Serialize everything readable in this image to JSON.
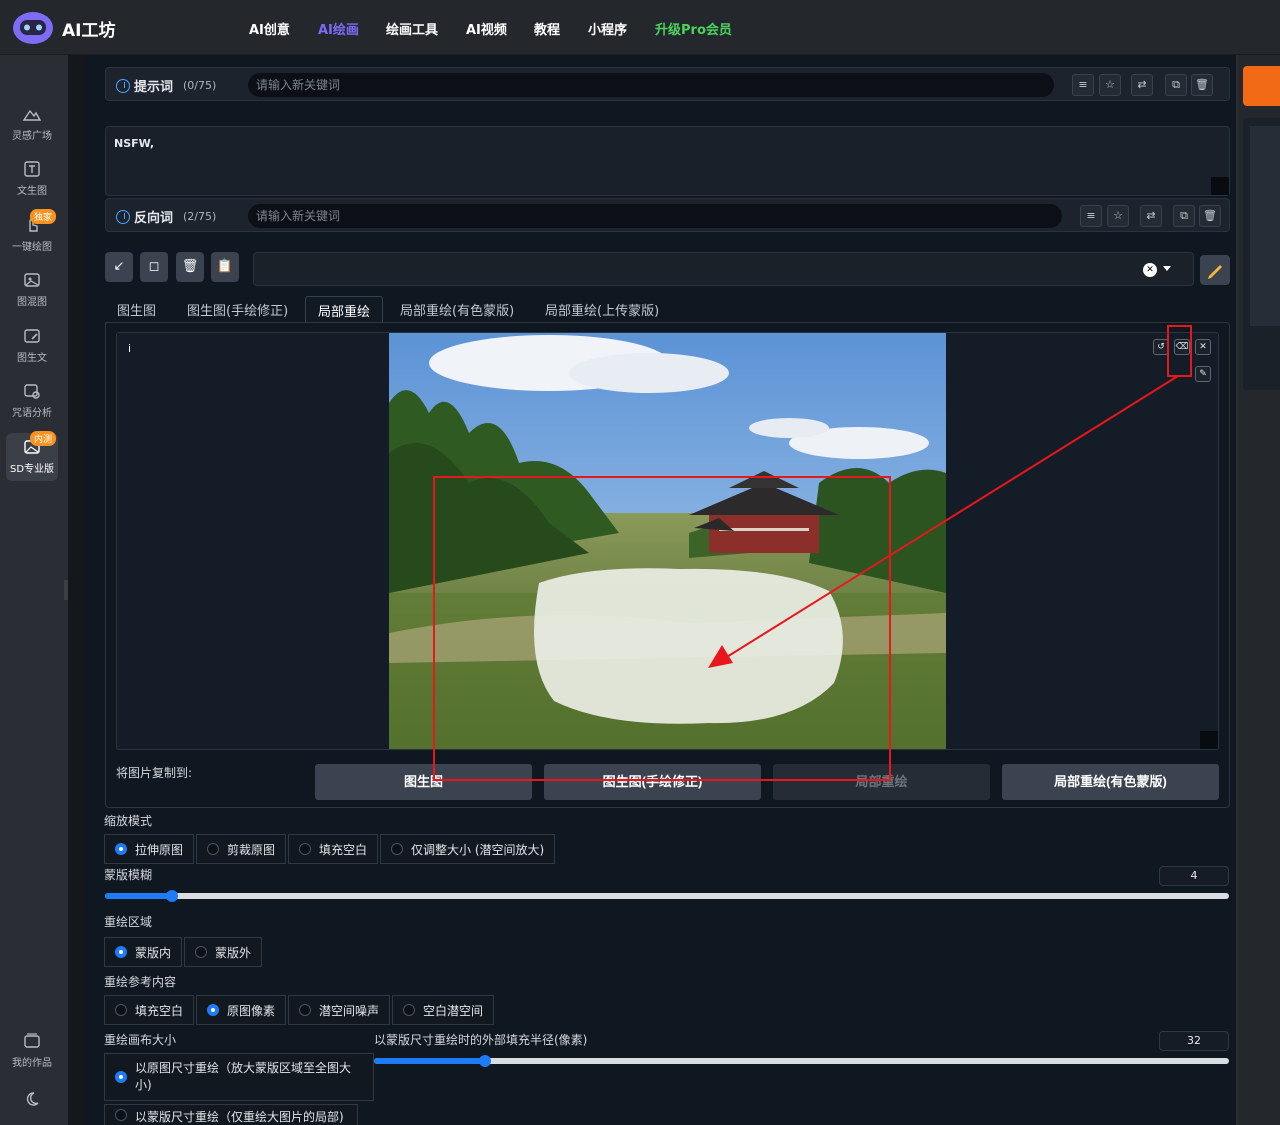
{
  "app": {
    "title": "AI工坊"
  },
  "nav": {
    "items": [
      {
        "label": "AI创意"
      },
      {
        "label": "AI绘画"
      },
      {
        "label": "绘画工具"
      },
      {
        "label": "AI视频"
      },
      {
        "label": "教程"
      },
      {
        "label": "小程序"
      },
      {
        "label": "升级Pro会员"
      }
    ],
    "active": "AI绘画"
  },
  "sidebar": {
    "items": [
      {
        "label": "灵感广场",
        "icon": "mountain-icon"
      },
      {
        "label": "文生图",
        "icon": "text-image-icon"
      },
      {
        "label": "一键绘图",
        "icon": "hand-pointer-icon",
        "badge": "独家"
      },
      {
        "label": "图混图",
        "icon": "image-mix-icon"
      },
      {
        "label": "图生文",
        "icon": "image-edit-icon"
      },
      {
        "label": "咒语分析",
        "icon": "image-search-icon"
      },
      {
        "label": "SD专业版",
        "icon": "image-pro-icon",
        "badge": "内测",
        "active": true
      }
    ],
    "bottom": [
      {
        "label": "我的作品",
        "icon": "gallery-icon"
      },
      {
        "label": "",
        "icon": "theme-toggle-icon"
      }
    ]
  },
  "prompt": {
    "label": "提示词",
    "count": "(0/75)",
    "placeholder": "请输入新关键词",
    "text": "NSFW,"
  },
  "negative": {
    "label": "反向词",
    "count": "(2/75)",
    "placeholder": "请输入新关键词"
  },
  "tabs": [
    {
      "label": "图生图"
    },
    {
      "label": "图生图(手绘修正)"
    },
    {
      "label": "局部重绘",
      "active": true
    },
    {
      "label": "局部重绘(有色蒙版)"
    },
    {
      "label": "局部重绘(上传蒙版)"
    }
  ],
  "canvas": {
    "info": "i"
  },
  "copy_to": {
    "label": "将图片复制到:",
    "buttons": [
      {
        "label": "图生图"
      },
      {
        "label": "图生图(手绘修正)"
      },
      {
        "label": "局部重绘",
        "disabled": true
      },
      {
        "label": "局部重绘(有色蒙版)"
      }
    ]
  },
  "resize_mode": {
    "label": "缩放模式",
    "options": [
      "拉伸原图",
      "剪裁原图",
      "填充空白",
      "仅调整大小 (潜空间放大)"
    ],
    "selected": 0
  },
  "mask_blur": {
    "label": "蒙版模糊",
    "value": "4",
    "fraction": 0.06
  },
  "inpaint_area": {
    "label": "重绘区域",
    "options": [
      "蒙版内",
      "蒙版外"
    ],
    "selected": 0
  },
  "masked_content": {
    "label": "重绘参考内容",
    "options": [
      "填充空白",
      "原图像素",
      "潜空间噪声",
      "空白潜空间"
    ],
    "selected": 1
  },
  "inpaint_size": {
    "label": "重绘画布大小",
    "options": [
      "以原图尺寸重绘（放大蒙版区域至全图大小)",
      "以蒙版尺寸重绘（仅重绘大图片的局部)"
    ],
    "selected": 0
  },
  "padding": {
    "label": "以蒙版尺寸重绘时的外部填充半径(像素)",
    "value": "32",
    "fraction": 0.13
  },
  "colors": {
    "accent": "#1e7bf6",
    "nav_active": "#7c6cf6",
    "pro": "#4bd35f",
    "orange": "#f26a16",
    "annotation": "#e8171b"
  }
}
